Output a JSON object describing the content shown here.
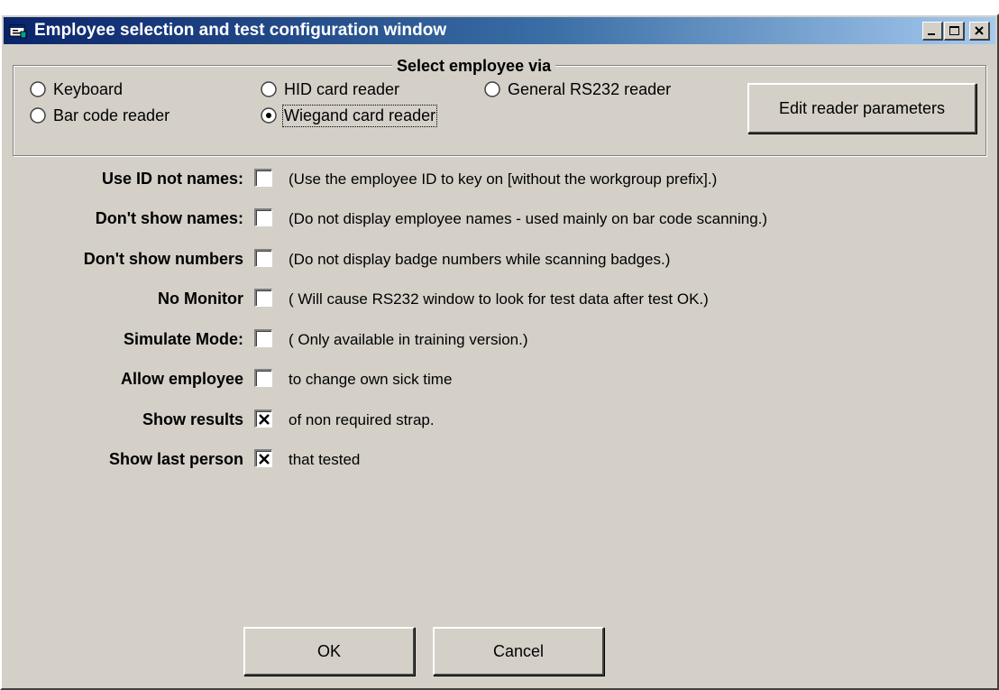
{
  "window": {
    "title": "Employee selection and test configuration window"
  },
  "select_group": {
    "legend": "Select employee via",
    "options": [
      {
        "label": "Keyboard",
        "selected": false
      },
      {
        "label": "Bar code reader",
        "selected": false
      },
      {
        "label": "HID card reader",
        "selected": false
      },
      {
        "label": "Wiegand card reader",
        "selected": true
      },
      {
        "label": "General RS232 reader",
        "selected": false
      }
    ],
    "edit_button": "Edit reader parameters"
  },
  "options": [
    {
      "label": "Use ID not names:",
      "checked": false,
      "description": "(Use the employee ID to key on [without the workgroup prefix].)"
    },
    {
      "label": "Don't show names:",
      "checked": false,
      "description": "(Do not display employee names - used mainly on bar code scanning.)"
    },
    {
      "label": "Don't show numbers",
      "checked": false,
      "description": "(Do not display badge numbers while scanning badges.)"
    },
    {
      "label": "No Monitor",
      "checked": false,
      "description": "( Will cause RS232 window to look for test data after test OK.)"
    },
    {
      "label": "Simulate Mode:",
      "checked": false,
      "description": "( Only available in training version.)"
    },
    {
      "label": "Allow employee",
      "checked": false,
      "description": "to change own sick time"
    },
    {
      "label": "Show results",
      "checked": true,
      "description": "of non required strap."
    },
    {
      "label": "Show last person",
      "checked": true,
      "description": "that tested"
    }
  ],
  "buttons": {
    "ok": "OK",
    "cancel": "Cancel"
  }
}
